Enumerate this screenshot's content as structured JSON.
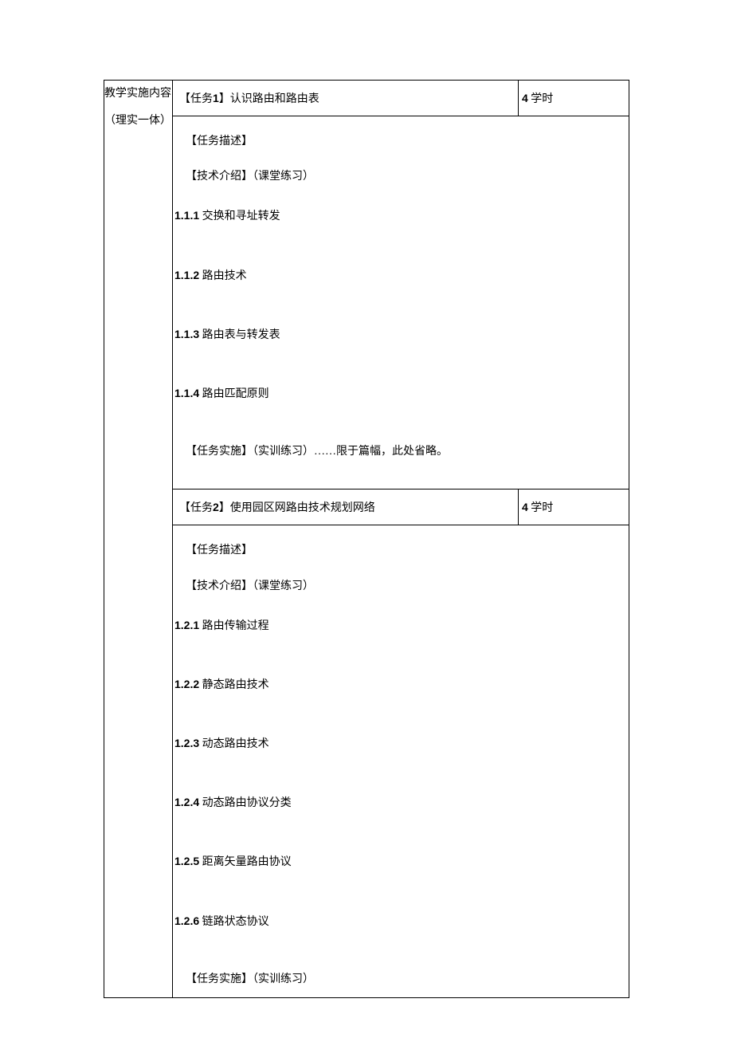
{
  "leftLabel": "教学实施内容（理实一体）",
  "task1": {
    "title_prefix": "【任务",
    "title_num": "1",
    "title_suffix": "】认识路由和路由表",
    "hours_num": "4",
    "hours_suffix": " 学时",
    "desc": "【任务描述】",
    "tech": "【技术介绍】（课堂练习）",
    "items": [
      {
        "num": "1.1.1",
        "text": "  交换和寻址转发"
      },
      {
        "num": "1.1.2",
        "text": "  路由技术"
      },
      {
        "num": "1.1.3",
        "text": "  路由表与转发表"
      },
      {
        "num": "1.1.4",
        "text": "  路由匹配原则"
      }
    ],
    "impl": "【任务实施】（实训练习）……限于篇幅，此处省略。"
  },
  "task2": {
    "title_prefix": "【任务",
    "title_num": "2",
    "title_suffix": "】使用园区网路由技术规划网络",
    "hours_num": "4",
    "hours_suffix": " 学时",
    "desc": "【任务描述】",
    "tech": "【技术介绍】（课堂练习）",
    "items": [
      {
        "num": "1.2.1",
        "text": " 路由传输过程"
      },
      {
        "num": "1.2.2",
        "text": " 静态路由技术"
      },
      {
        "num": "1.2.3",
        "text": " 动态路由技术"
      },
      {
        "num": "1.2.4",
        "text": " 动态路由协议分类"
      },
      {
        "num": "1.2.5",
        "text": " 距离矢量路由协议"
      },
      {
        "num": "1.2.6",
        "text": " 链路状态协议"
      }
    ],
    "impl": "【任务实施】（实训练习）"
  }
}
